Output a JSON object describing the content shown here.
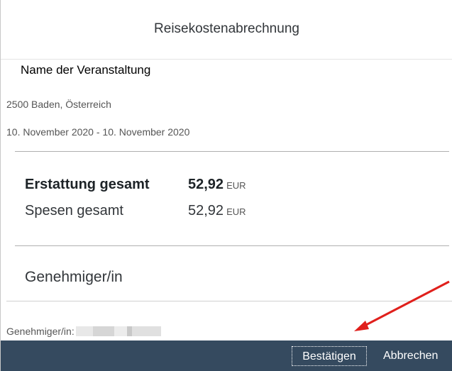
{
  "dialog": {
    "title": "Reisekostenabrechnung",
    "event_name": "Name der Veranstaltung",
    "location": "2500 Baden, Österreich",
    "dates": "10. November 2020 - 10. November 2020"
  },
  "totals": {
    "reimbursement_label": "Erstattung gesamt",
    "reimbursement_amount": "52,92",
    "reimbursement_currency": "EUR",
    "expenses_label": "Spesen gesamt",
    "expenses_amount": "52,92",
    "expenses_currency": "EUR"
  },
  "approver": {
    "section_title": "Genehmiger/in",
    "field_label": "Genehmiger/in:"
  },
  "footer": {
    "confirm_label": "Bestätigen",
    "cancel_label": "Abbrechen"
  },
  "colors": {
    "footer_bg": "#354a5f",
    "annotation_arrow": "#e0201c"
  }
}
